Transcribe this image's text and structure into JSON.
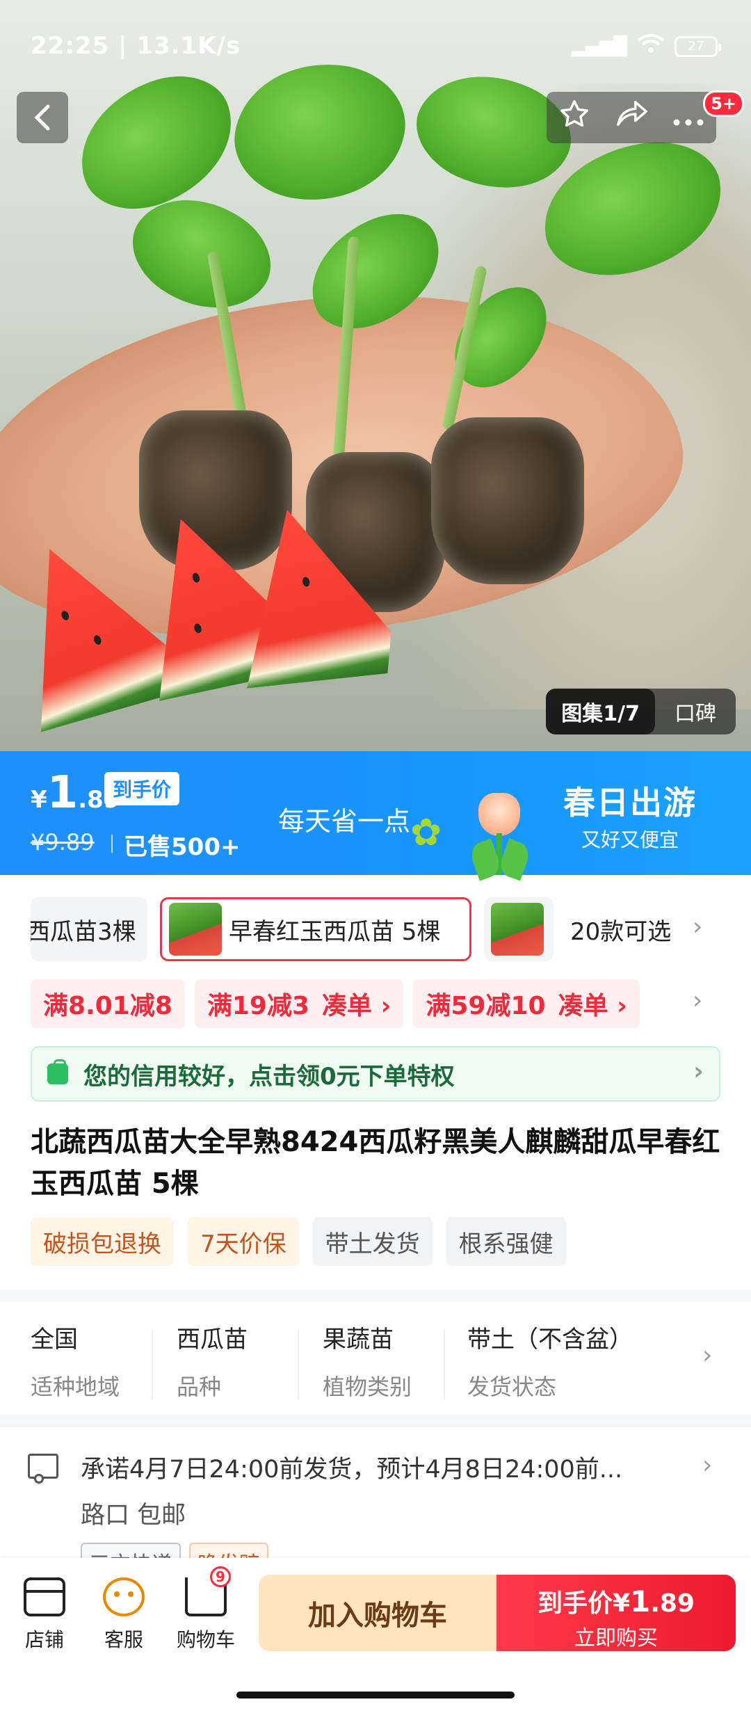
{
  "status_bar": {
    "time": "22:25",
    "speed": "13.1K/s",
    "battery": "27"
  },
  "hero": {
    "more_badge": "5+",
    "gallery_label": "图集1/7",
    "reviews_label": "口碑"
  },
  "banner": {
    "currency": "¥",
    "price_int": "1",
    "price_dec": ".89",
    "price_tag": "到手价",
    "old_price": "¥9.89",
    "sold": "已售500+",
    "promo": "每天省一点",
    "campaign_title": "春日出游",
    "campaign_sub": "又好又便宜",
    "accent": "#1e8ffb"
  },
  "sku": {
    "items": [
      "西瓜苗3棵",
      "早春红玉西瓜苗 5棵"
    ],
    "count_label": "20款可选",
    "selected_index": 1
  },
  "coupons": [
    {
      "text": "满8.01减8",
      "action": ""
    },
    {
      "text": "满19减3",
      "action": "凑单 ›"
    },
    {
      "text": "满59减10",
      "action": "凑单 ›"
    }
  ],
  "credit": {
    "text": "您的信用较好，点击领0元下单特权"
  },
  "product": {
    "title": "北蔬西瓜苗大全早熟8424西瓜籽黑美人麒麟甜瓜早春红玉西瓜苗 5棵",
    "tags": [
      "破损包退换",
      "7天价保",
      "带土发货",
      "根系强健"
    ]
  },
  "attributes": [
    {
      "value": "全国",
      "key": "适种地域"
    },
    {
      "value": "西瓜苗",
      "key": "品种"
    },
    {
      "value": "果蔬苗",
      "key": "植物类别"
    },
    {
      "value": "带土（不含盆）",
      "key": "发货状态"
    }
  ],
  "delivery": {
    "line1": "承诺4月7日24:00前发货，预计4月8日24:00前...",
    "line2": "路口 包邮",
    "tags": [
      "三方快递",
      "晚发赔"
    ]
  },
  "bottom_bar": {
    "store": "店铺",
    "service": "客服",
    "cart": "购物车",
    "cart_count": "9",
    "add_to_cart": "加入购物车",
    "buy_price_label": "到手价¥",
    "buy_price_int": "1",
    "buy_price_dec": ".89",
    "buy_now": "立即购买",
    "buy_color": "#f01a2e"
  }
}
